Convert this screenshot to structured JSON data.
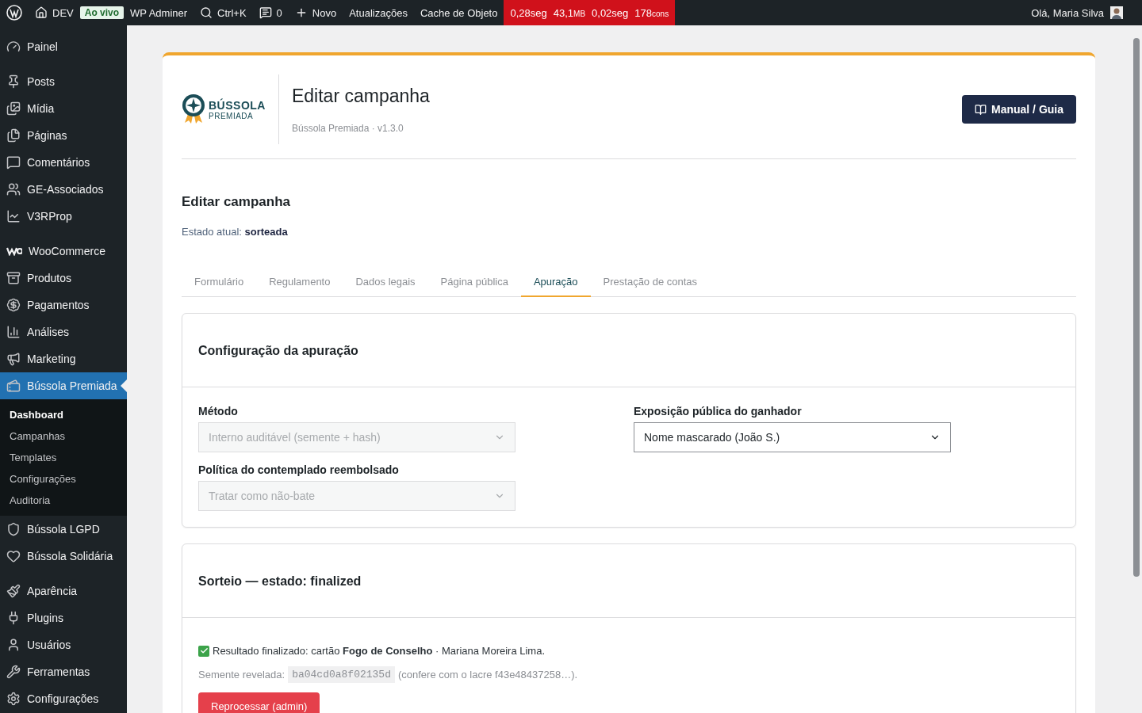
{
  "admin_bar": {
    "site": "DEV",
    "live_badge": "Ao vivo",
    "items": [
      {
        "kind": "text",
        "label": "WP Adminer"
      },
      {
        "kind": "search",
        "label": "Ctrl+K"
      },
      {
        "kind": "comments",
        "label": "0"
      },
      {
        "kind": "new",
        "label": "Novo"
      },
      {
        "kind": "text",
        "label": "Atualizações"
      },
      {
        "kind": "text",
        "label": "Cache de Objeto"
      }
    ],
    "metrics": [
      {
        "value": "0,28seg"
      },
      {
        "value": "43,1",
        "unit": "MB"
      },
      {
        "value": "0,02seg"
      },
      {
        "value": "178",
        "unit": "cons"
      }
    ],
    "greeting": "Olá, Maria Silva"
  },
  "sidebar": {
    "groups": [
      [
        {
          "label": "Painel",
          "selected": false
        }
      ],
      [
        {
          "label": "Posts",
          "selected": false
        },
        {
          "label": "Mídia",
          "selected": false
        },
        {
          "label": "Páginas",
          "selected": false
        },
        {
          "label": "Comentários",
          "selected": false
        },
        {
          "label": "GE-Associados",
          "selected": false
        },
        {
          "label": "V3RProp",
          "selected": false
        }
      ],
      [
        {
          "label": "WooCommerce",
          "selected": false
        },
        {
          "label": "Produtos",
          "selected": false
        },
        {
          "label": "Pagamentos",
          "selected": false
        },
        {
          "label": "Análises",
          "selected": false
        },
        {
          "label": "Marketing",
          "selected": false
        },
        {
          "label": "Bússola Premiada",
          "selected": true,
          "children": [
            {
              "label": "Dashboard",
              "selected": true
            },
            {
              "label": "Campanhas",
              "selected": false
            },
            {
              "label": "Templates",
              "selected": false
            },
            {
              "label": "Configurações",
              "selected": false
            },
            {
              "label": "Auditoria",
              "selected": false
            }
          ]
        },
        {
          "label": "Bússola LGPD",
          "selected": false
        },
        {
          "label": "Bússola Solidária",
          "selected": false
        }
      ],
      [
        {
          "label": "Aparência",
          "selected": false
        },
        {
          "label": "Plugins",
          "selected": false
        },
        {
          "label": "Usuários",
          "selected": false
        },
        {
          "label": "Ferramentas",
          "selected": false
        },
        {
          "label": "Configurações",
          "selected": false
        }
      ]
    ]
  },
  "header": {
    "logo": {
      "line1": "BÚSSOLA",
      "line2": "PREMIADA"
    },
    "title": "Editar campanha",
    "subtitle": "Bússola Premiada · v1.3.0",
    "guide_button": "Manual / Guia"
  },
  "section_title": "Editar campanha",
  "status": "Estado atual: **sorteada**",
  "tabs": [
    {
      "label": "Formulário",
      "selected": false
    },
    {
      "label": "Regulamento",
      "selected": false
    },
    {
      "label": "Dados legais",
      "selected": false
    },
    {
      "label": "Página pública",
      "selected": false
    },
    {
      "label": "Apuração",
      "selected": true
    },
    {
      "label": "Prestação de contas",
      "selected": false
    }
  ],
  "config_panel": {
    "title": "Configuração da apuração",
    "fields": [
      {
        "label": "Método",
        "value": "Interno auditável (semente + hash)",
        "disabled": true
      },
      {
        "label": "Exposição pública do ganhador",
        "value": "Nome mascarado (João S.)",
        "disabled": false
      },
      {
        "label": "Política do contemplado reembolsado",
        "value": "Tratar como não-bate",
        "disabled": true
      }
    ]
  },
  "draw_panel": {
    "title": "Sorteio — estado: finalized",
    "result": "Resultado finalizado: cartão **Fogo de Conselho** · Mariana Moreira Lima.",
    "seed_label": "Semente revelada:",
    "seed": "ba04cd0a8f02135d",
    "seed_note": "(confere com o lacre f43e48437258…).",
    "reprocess_button": "Reprocessar (admin)"
  }
}
